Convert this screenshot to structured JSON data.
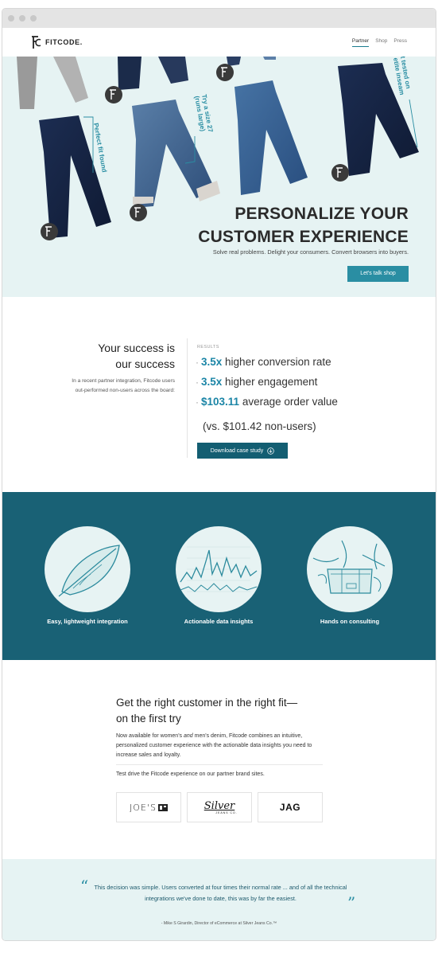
{
  "nav": {
    "brand": "FITCODE.",
    "links": [
      "Partner",
      "Shop",
      "Press"
    ]
  },
  "hero": {
    "title_line1": "PERSONALIZE YOUR",
    "title_line2": "CUSTOMER EXPERIENCE",
    "subtitle": "Solve real problems. Delight your consumers. Convert browsers into buyers.",
    "cta": "Let's talk shop",
    "annotations": {
      "fit_found": "Perfect fit found",
      "size_line1": "Try a size 27",
      "size_line2": "(runs large)",
      "tested_line1": "t tested on",
      "tested_line2": "etite inseam"
    }
  },
  "success": {
    "title_line1": "Your success is",
    "title_line2": "our success",
    "description": "In a recent partner integration, Fitcode users out-performed non-users across the board:",
    "results_label": "RESULTS",
    "results": [
      {
        "value": "3.5x",
        "text": "higher conversion rate"
      },
      {
        "value": "3.5x",
        "text": "higher engagement"
      },
      {
        "value": "$103.11",
        "text": "average order value"
      }
    ],
    "result_note": "(vs. $101.42 non-users)",
    "download": "Download case study"
  },
  "features": [
    {
      "label": "Easy, lightweight integration",
      "icon": "feather-icon"
    },
    {
      "label": "Actionable data insights",
      "icon": "data-chart-icon"
    },
    {
      "label": "Hands on consulting",
      "icon": "consulting-hands-icon"
    }
  ],
  "fit": {
    "title_line1": "Get the right customer in the right fit—",
    "title_line2": "on the first try",
    "text_pre": "Now available for women's ",
    "text_and": "and",
    "text_post": " men's denim, Fitcode combines an intuitive, personalized customer experience with the actionable data insights you need to increase sales and loyalty.",
    "test_drive": "Test drive the Fitcode experience on our partner brand sites.",
    "brands": [
      "JOE'S",
      "Silver",
      "JAG"
    ],
    "silver_sub": "JEANS CO."
  },
  "quote": {
    "text": "This decision was simple. Users converted at four times their normal rate ... and of all the technical integrations we've done to date, this was by far the easiest.",
    "author": "- Mike S Girardin, Director of eCommerce at Silver Jeans Co.™"
  },
  "colors": {
    "teal": "#2a8ea3",
    "dark_teal": "#196175",
    "light_bg": "#e6f3f3"
  }
}
